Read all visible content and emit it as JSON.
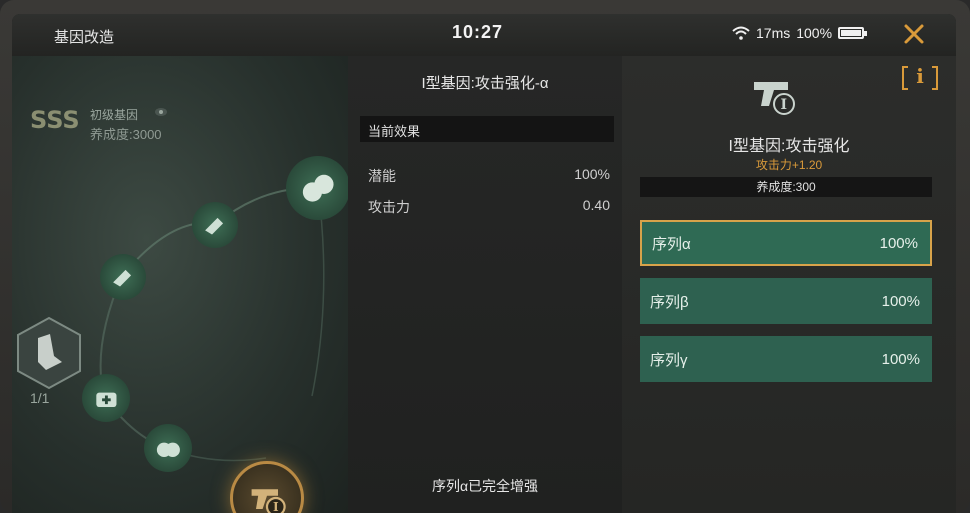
{
  "header": {
    "title": "基因改造",
    "clock": "10:27",
    "latency": "17ms",
    "battery": "100%"
  },
  "tree": {
    "tier_label": "初级基因",
    "cultivation": "养成度:3000",
    "page_count": "1/1",
    "badge_text": "SSS"
  },
  "middle": {
    "title": "I型基因:攻击强化-α",
    "effect_header": "当前效果",
    "stats": [
      {
        "label": "潜能",
        "value": "100%"
      },
      {
        "label": "攻击力",
        "value": "0.40"
      }
    ],
    "footer": "序列α已完全增强"
  },
  "right": {
    "info_label": "i",
    "gene_name": "I型基因:攻击强化",
    "bonus": "攻击力+1.20",
    "cultivation": "养成度:300",
    "sequences": [
      {
        "label": "序列α",
        "value": "100%"
      },
      {
        "label": "序列β",
        "value": "100%"
      },
      {
        "label": "序列γ",
        "value": "100%"
      }
    ]
  },
  "colors": {
    "accent_orange": "#d99a3a",
    "sequence_green": "#2e6150",
    "node_green": "#3e6e55"
  }
}
